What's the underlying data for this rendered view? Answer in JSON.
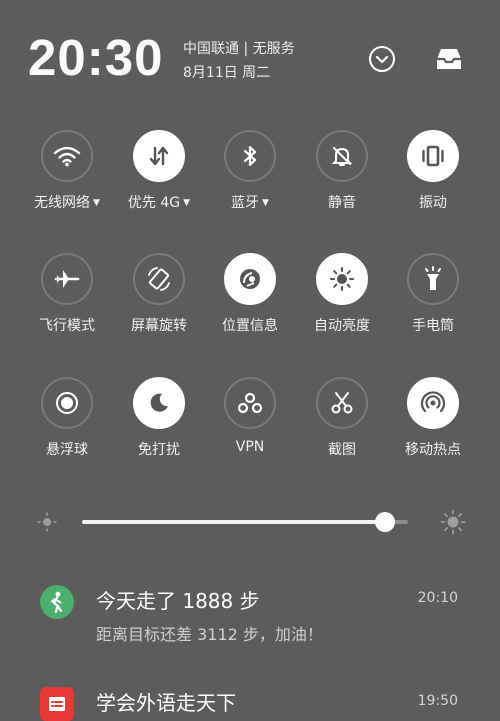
{
  "header": {
    "time": "20:30",
    "carrier": "中国联通 | 无服务",
    "date": "8月11日 周二"
  },
  "tiles": [
    {
      "label": "无线网络",
      "caret": "▼",
      "icon": "wifi-icon",
      "on": false
    },
    {
      "label": "优先 4G",
      "caret": "▼",
      "icon": "data-arrows-icon",
      "on": true
    },
    {
      "label": "蓝牙",
      "caret": "▼",
      "icon": "bluetooth-icon",
      "on": false
    },
    {
      "label": "静音",
      "caret": "",
      "icon": "bell-off-icon",
      "on": false
    },
    {
      "label": "振动",
      "caret": "",
      "icon": "vibrate-icon",
      "on": true
    },
    {
      "label": "飞行模式",
      "caret": "",
      "icon": "airplane-icon",
      "on": false
    },
    {
      "label": "屏幕旋转",
      "caret": "",
      "icon": "rotate-icon",
      "on": false
    },
    {
      "label": "位置信息",
      "caret": "",
      "icon": "location-icon",
      "on": true
    },
    {
      "label": "自动亮度",
      "caret": "",
      "icon": "auto-brightness-icon",
      "on": true
    },
    {
      "label": "手电筒",
      "caret": "",
      "icon": "flashlight-icon",
      "on": false
    },
    {
      "label": "悬浮球",
      "caret": "",
      "icon": "floating-ball-icon",
      "on": false
    },
    {
      "label": "免打扰",
      "caret": "",
      "icon": "moon-icon",
      "on": true
    },
    {
      "label": "VPN",
      "caret": "",
      "icon": "vpn-icon",
      "on": false
    },
    {
      "label": "截图",
      "caret": "",
      "icon": "scissors-icon",
      "on": false
    },
    {
      "label": "移动热点",
      "caret": "",
      "icon": "hotspot-icon",
      "on": true
    }
  ],
  "brightness": {
    "level": 0.93
  },
  "notifications": [
    {
      "title": "今天走了 1888 步",
      "body": "距离目标还差 3112 步，加油！",
      "time": "20:10",
      "icon": "walker-icon",
      "color": "#4caf6e"
    },
    {
      "title": "学会外语走天下",
      "body": "",
      "time": "19:50",
      "icon": "list-icon",
      "color": "#e53935"
    }
  ],
  "colors": {
    "background": "#5c5c5c",
    "tile_on": "#ffffff",
    "tile_off_border": "#7b7b7b"
  }
}
